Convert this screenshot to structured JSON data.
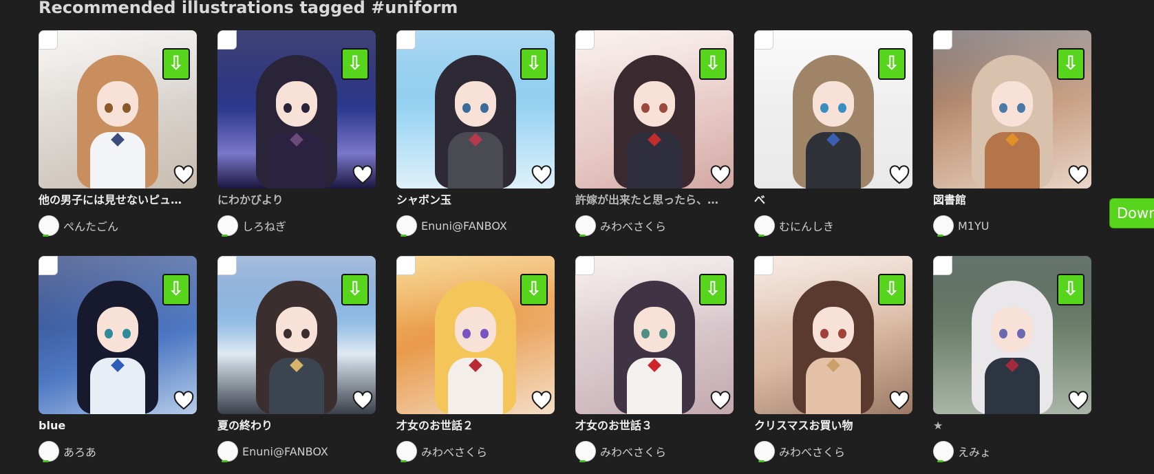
{
  "section": {
    "title": "Recommended illustrations tagged #uniform"
  },
  "side_button": {
    "label": "Down"
  },
  "colors": {
    "background": "#1f1f1f",
    "download_green": "#57d51c",
    "title_text": "#f0f0f0",
    "muted_text": "#cfcfcf"
  },
  "icons": {
    "download": "arrow-down-icon",
    "like": "heart-outline-icon",
    "select": "checkbox"
  },
  "cards": [
    {
      "title": "他の男子には見せないピュ…",
      "author": "ぺんたごん",
      "dim": false
    },
    {
      "title": "にわかびより",
      "author": "しろねぎ",
      "dim": true
    },
    {
      "title": "シャボン玉",
      "author": "Enuni@FANBOX",
      "dim": false
    },
    {
      "title": "許嫁が出来たと思ったら、…",
      "author": "みわべさくら",
      "dim": true
    },
    {
      "title": "べ",
      "author": "むにんしき",
      "dim": false
    },
    {
      "title": "図書館",
      "author": "M1YU",
      "dim": false
    },
    {
      "title": "blue",
      "author": "あろあ",
      "dim": false
    },
    {
      "title": "夏の終わり",
      "author": "Enuni@FANBOX",
      "dim": false
    },
    {
      "title": "才女のお世話２",
      "author": "みわべさくら",
      "dim": false
    },
    {
      "title": "才女のお世話３",
      "author": "みわべさくら",
      "dim": false
    },
    {
      "title": "クリスマスお買い物",
      "author": "みわべさくら",
      "dim": false
    },
    {
      "title": "★",
      "author": "えみょ",
      "dim": true
    }
  ]
}
